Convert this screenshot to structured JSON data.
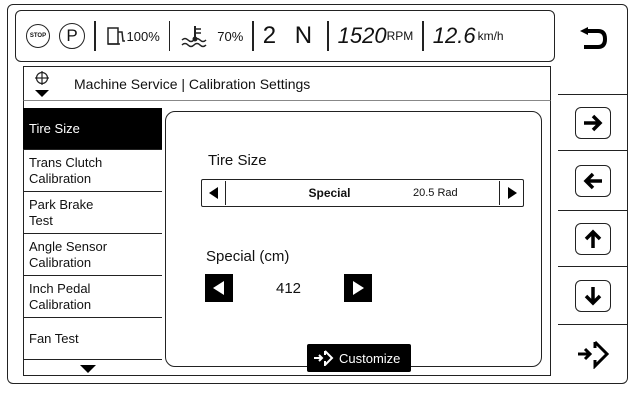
{
  "status": {
    "stop_icon_label": "STOP",
    "park_icon_label": "P",
    "fuel": "100%",
    "coolant": "70%",
    "gear": "2 N",
    "rpm_value": "1520",
    "rpm_unit": "RPM",
    "speed_value": "12.6",
    "speed_unit": "km/h"
  },
  "header": {
    "title": "Machine Service | Calibration Settings"
  },
  "menu": {
    "items": [
      {
        "label": "Tire Size",
        "selected": true
      },
      {
        "label": "Trans Clutch Calibration",
        "selected": false
      },
      {
        "label": "Park Brake Test",
        "selected": false
      },
      {
        "label": "Angle Sensor Calibration",
        "selected": false
      },
      {
        "label": "Inch Pedal Calibration",
        "selected": false
      },
      {
        "label": "Fan Test",
        "selected": false
      }
    ]
  },
  "panel": {
    "tire_size_label": "Tire Size",
    "tire_selection": "Special",
    "tire_detail": "20.5 Rad",
    "special_label": "Special (cm)",
    "special_value": "412",
    "customize_label": "Customize"
  },
  "right_buttons": [
    "back-icon",
    "arrow-right-icon",
    "arrow-left-icon",
    "arrow-up-icon",
    "arrow-down-icon",
    "enter-icon"
  ]
}
